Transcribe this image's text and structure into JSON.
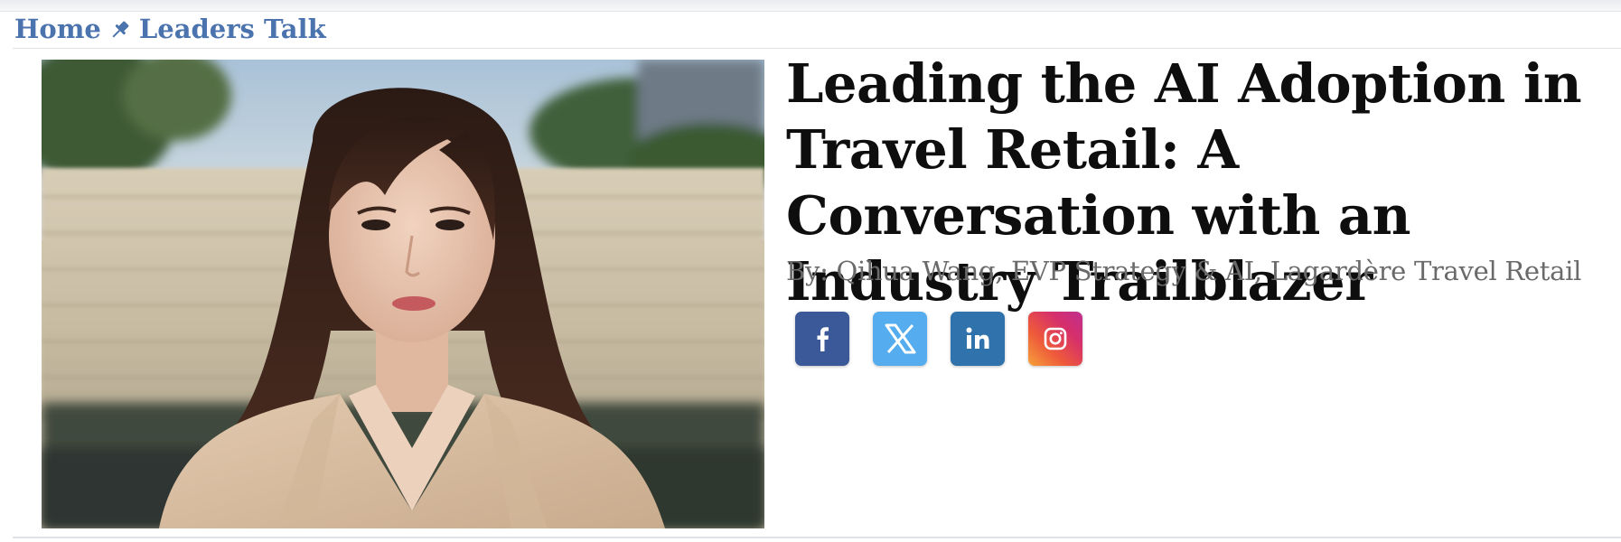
{
  "breadcrumb": {
    "home_label": "Home",
    "separator_icon": "pin-icon",
    "section_label": "Leaders Talk",
    "link_color": "#4b73ad"
  },
  "article": {
    "headline": "Leading the AI Adoption in Travel Retail: A Conversation with an Industry Trailblazer",
    "byline": "By: Qihua Wang, EVP Strategy & AI, Lagardère Travel Retail",
    "photo": {
      "subject": "portrait-photo"
    }
  },
  "share": [
    {
      "network": "facebook",
      "icon": "facebook-icon",
      "color": "#3b5998"
    },
    {
      "network": "x",
      "icon": "x-icon",
      "color": "#55acee"
    },
    {
      "network": "linkedin",
      "icon": "linkedin-icon",
      "color": "#2f72ac"
    },
    {
      "network": "instagram",
      "icon": "instagram-icon",
      "color": "#d62f6b"
    }
  ]
}
